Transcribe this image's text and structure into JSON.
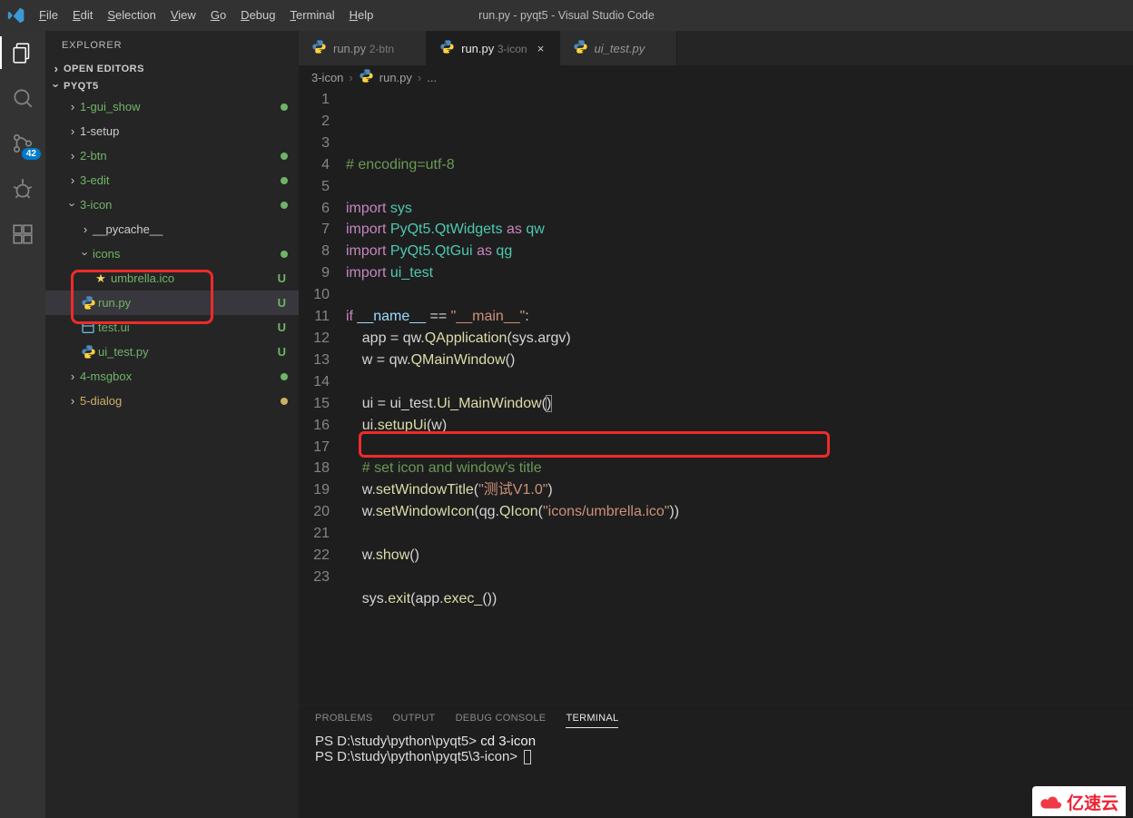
{
  "window_title": "run.py - pyqt5 - Visual Studio Code",
  "menu": {
    "file": "File",
    "edit": "Edit",
    "selection": "Selection",
    "view": "View",
    "go": "Go",
    "debug": "Debug",
    "terminal": "Terminal",
    "help": "Help"
  },
  "activity": {
    "scm_badge": "42"
  },
  "explorer": {
    "title": "EXPLORER",
    "open_editors": "OPEN EDITORS",
    "root": "PYQT5",
    "items": [
      {
        "name": "1-gui_show",
        "kind": "folder",
        "depth": 0,
        "expand": "›",
        "cls": "green",
        "status": "dot"
      },
      {
        "name": "1-setup",
        "kind": "folder",
        "depth": 0,
        "expand": "›"
      },
      {
        "name": "2-btn",
        "kind": "folder",
        "depth": 0,
        "expand": "›",
        "cls": "green",
        "status": "dot"
      },
      {
        "name": "3-edit",
        "kind": "folder",
        "depth": 0,
        "expand": "›",
        "cls": "green",
        "status": "dot"
      },
      {
        "name": "3-icon",
        "kind": "folder",
        "depth": 0,
        "expand": "v",
        "cls": "green",
        "status": "dot"
      },
      {
        "name": "__pycache__",
        "kind": "folder",
        "depth": 1,
        "expand": "›"
      },
      {
        "name": "icons",
        "kind": "folder",
        "depth": 1,
        "expand": "v",
        "cls": "green",
        "status": "dot"
      },
      {
        "name": "umbrella.ico",
        "kind": "ico",
        "depth": 2,
        "cls": "green",
        "status": "U"
      },
      {
        "name": "run.py",
        "kind": "py",
        "depth": 1,
        "cls": "green",
        "status": "U",
        "selected": true
      },
      {
        "name": "test.ui",
        "kind": "ui",
        "depth": 1,
        "cls": "green",
        "status": "U"
      },
      {
        "name": "ui_test.py",
        "kind": "py",
        "depth": 1,
        "cls": "green",
        "status": "U"
      },
      {
        "name": "4-msgbox",
        "kind": "folder",
        "depth": 0,
        "expand": "›",
        "cls": "green",
        "status": "dot"
      },
      {
        "name": "5-dialog",
        "kind": "folder",
        "depth": 0,
        "expand": "›",
        "cls": "yel",
        "status": "dot-yel"
      }
    ]
  },
  "tabs": [
    {
      "icon": "py",
      "label": "run.py",
      "dir": "2-btn",
      "active": false
    },
    {
      "icon": "py",
      "label": "run.py",
      "dir": "3-icon",
      "active": true
    },
    {
      "icon": "py",
      "label": "ui_test.py",
      "dir": "",
      "active": false,
      "italic": true
    }
  ],
  "breadcrumb": {
    "seg1": "3-icon",
    "seg2": "run.py",
    "seg3": "..."
  },
  "code_lines": [
    {
      "n": 1,
      "html": "<span class='cm'># encoding=utf-8</span>"
    },
    {
      "n": 2,
      "html": ""
    },
    {
      "n": 3,
      "html": "<span class='kw'>import</span> <span class='cl'>sys</span>"
    },
    {
      "n": 4,
      "html": "<span class='kw'>import</span> <span class='cl'>PyQt5.QtWidgets</span> <span class='kw'>as</span> <span class='cl'>qw</span>"
    },
    {
      "n": 5,
      "html": "<span class='kw'>import</span> <span class='cl'>PyQt5.QtGui</span> <span class='kw'>as</span> <span class='cl'>qg</span>"
    },
    {
      "n": 6,
      "html": "<span class='kw'>import</span> <span class='cl'>ui_test</span>"
    },
    {
      "n": 7,
      "html": ""
    },
    {
      "n": 8,
      "html": "<span class='kw'>if</span> <span class='va'>__name__</span> == <span class='st'>\"__main__\"</span>:"
    },
    {
      "n": 9,
      "html": "    app = qw.<span class='fn'>QApplication</span>(sys.argv)"
    },
    {
      "n": 10,
      "html": "    w = qw.<span class='fn'>QMainWindow</span>()"
    },
    {
      "n": 11,
      "html": ""
    },
    {
      "n": 12,
      "html": "    ui = ui_test.<span class='fn'>Ui_MainWindow</span>(<span style='outline:1px solid #888'>)</span>"
    },
    {
      "n": 13,
      "html": "    ui.<span class='fn'>setupUi</span>(w)"
    },
    {
      "n": 14,
      "html": ""
    },
    {
      "n": 15,
      "html": "    <span class='cm'># set icon and window's title</span>"
    },
    {
      "n": 16,
      "html": "    w.<span class='fn'>setWindowTitle</span>(<span class='st'>\"测试V1.0\"</span>)"
    },
    {
      "n": 17,
      "html": "    w.<span class='fn'>setWindowIcon</span>(qg.<span class='fn'>QIcon</span>(<span class='st'>\"icons/umbrella.ico\"</span>))"
    },
    {
      "n": 18,
      "html": ""
    },
    {
      "n": 19,
      "html": "    w.<span class='fn'>show</span>()"
    },
    {
      "n": 20,
      "html": ""
    },
    {
      "n": 21,
      "html": "    sys.<span class='fn'>exit</span>(app.<span class='fn'>exec_</span>())"
    },
    {
      "n": 22,
      "html": ""
    },
    {
      "n": 23,
      "html": ""
    }
  ],
  "panel": {
    "tabs": {
      "problems": "PROBLEMS",
      "output": "OUTPUT",
      "debug": "DEBUG CONSOLE",
      "terminal": "TERMINAL"
    },
    "line1_prompt": "PS D:\\study\\python\\pyqt5> ",
    "line1_cmd": "cd 3-icon",
    "line2_prompt": "PS D:\\study\\python\\pyqt5\\3-icon> "
  },
  "watermark": "亿速云"
}
